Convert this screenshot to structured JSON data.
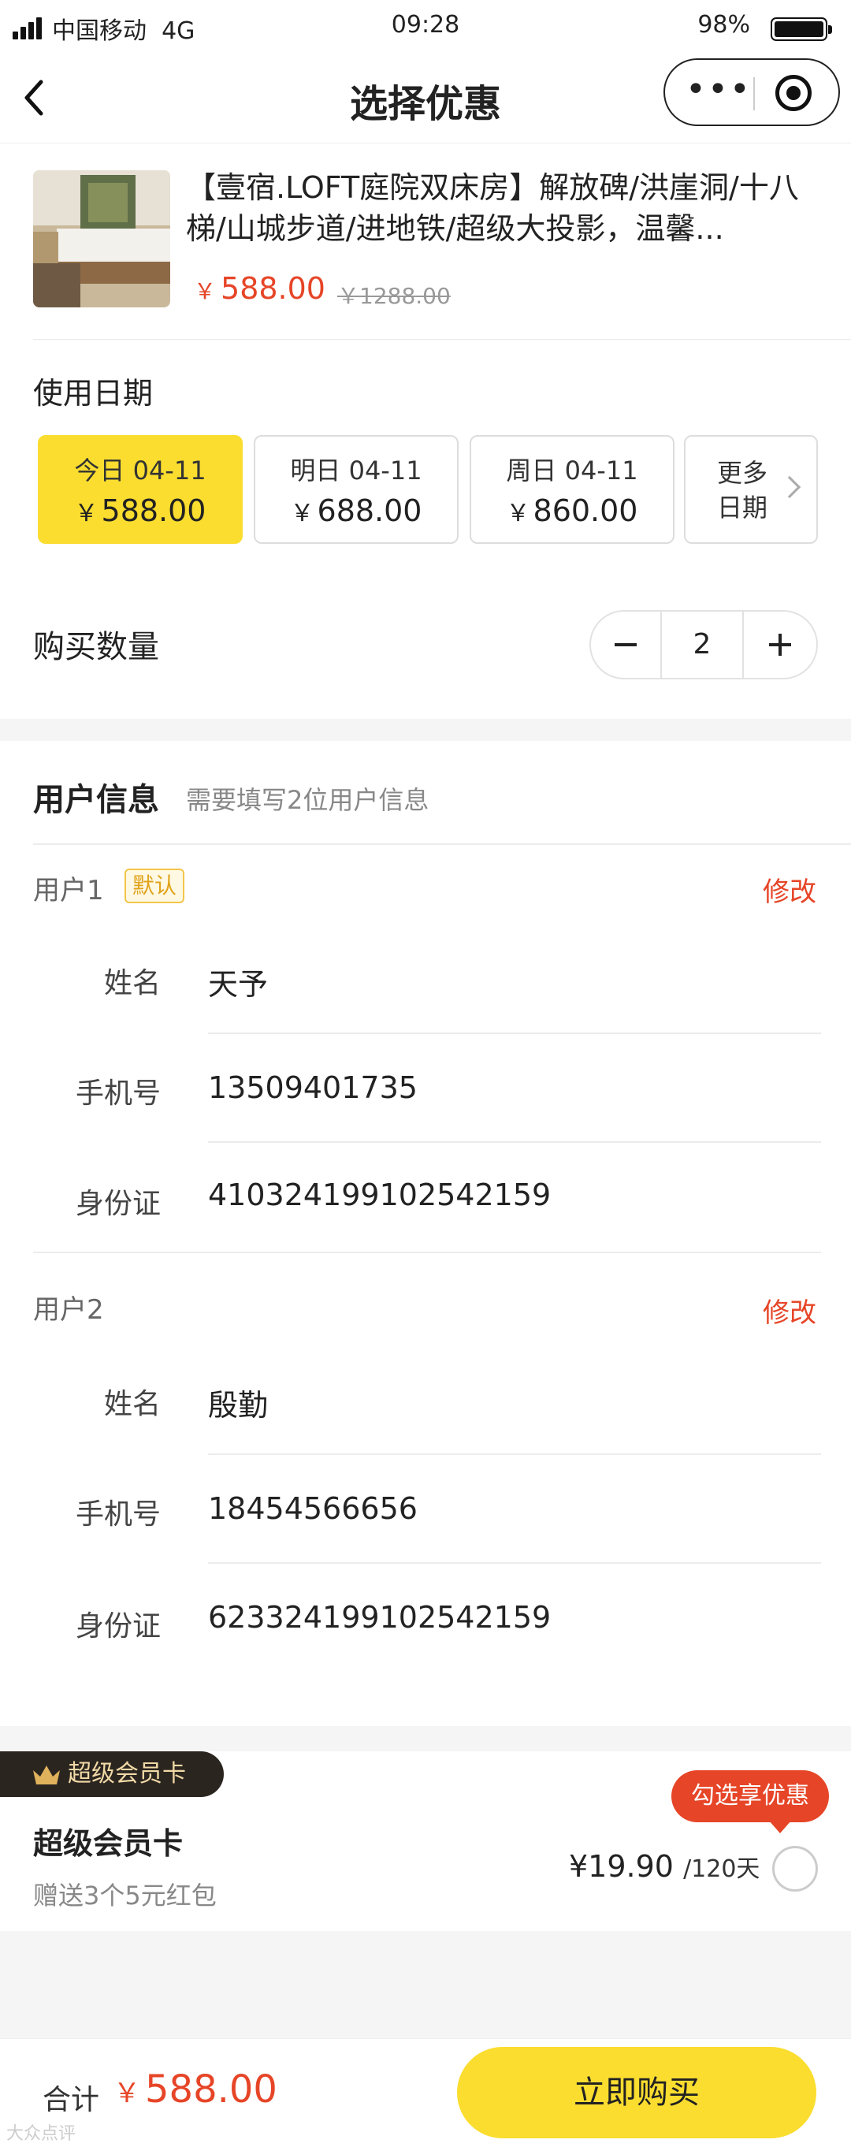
{
  "status_bar": {
    "carrier": "中国移动",
    "network": "4G",
    "time": "09:28",
    "battery": "98%"
  },
  "nav": {
    "title": "选择优惠",
    "more_glyph": "•••"
  },
  "product": {
    "title": "【壹宿.LOFT庭院双床房】解放碑/洪崖洞/十八梯/山城步道/进地铁/超级大投影，温馨...",
    "currency": "￥",
    "price": "588.00",
    "original_price": "￥1288.00"
  },
  "date_section": {
    "label": "使用日期",
    "options": [
      {
        "date": "今日 04-11",
        "currency": "￥",
        "price": "588.00"
      },
      {
        "date": "明日 04-11",
        "currency": "￥",
        "price": "688.00"
      },
      {
        "date": "周日 04-11",
        "currency": "￥",
        "price": "860.00"
      }
    ],
    "more_label": "更多日期"
  },
  "quantity": {
    "label": "购买数量",
    "value": "2"
  },
  "user_info": {
    "heading": "用户信息",
    "hint": "需要填写2位用户信息",
    "users": [
      {
        "label": "用户1",
        "badge": "默认",
        "edit": "修改",
        "name_label": "姓名",
        "name": "天予",
        "phone_label": "手机号",
        "phone": "13509401735",
        "id_label": "身份证",
        "id": "410324199102542159"
      },
      {
        "label": "用户2",
        "edit": "修改",
        "name_label": "姓名",
        "name": "殷勤",
        "phone_label": "手机号",
        "phone": "18454566656",
        "id_label": "身份证",
        "id": "623324199102542159"
      }
    ]
  },
  "member": {
    "tag": "超级会员卡",
    "title": "超级会员卡",
    "subtitle": "赠送3个5元红包",
    "price": "¥19.90",
    "unit": "/120天",
    "bubble": "勾选享优惠"
  },
  "bottom": {
    "total_label": "合计",
    "currency": "￥",
    "total": "588.00",
    "buy_label": "立即购买",
    "watermark": "大众点评"
  },
  "colors": {
    "accent_yellow": "#fadd2f",
    "price_red": "#e64527",
    "member_dark": "#2b2520"
  }
}
